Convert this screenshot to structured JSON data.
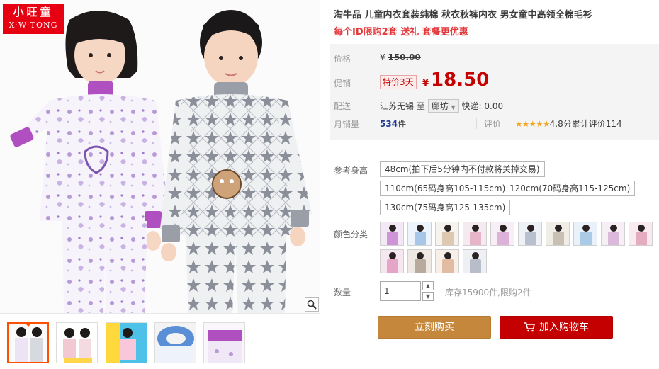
{
  "brand": {
    "logo_cn": "小旺童",
    "logo_en": "X·W·TONG"
  },
  "product": {
    "title": "淘牛品 儿童内衣套装纯棉 秋衣秋裤内衣 男女童中高领全棉毛衫",
    "subtitle": "每个ID限购2套 送礼 套餐更优惠"
  },
  "price": {
    "label": "价格",
    "currency": "¥",
    "original": "150.00",
    "promo_label": "促销",
    "promo_tag": "特价3天",
    "promo_price": "18.50"
  },
  "shipping": {
    "label": "配送",
    "from": "江苏无锡",
    "to_word": "至",
    "to_city": "廊坊",
    "fee_text": "快递: 0.00"
  },
  "sales": {
    "label": "月销量",
    "count": "534",
    "unit": "件",
    "review_label": "评价",
    "stars": "★★★★★",
    "score_text": "4.8分累计评价114"
  },
  "sizes": {
    "label": "参考身高",
    "options": [
      "48cm(拍下后5分钟内不付款将关掉交易)",
      "110cm(65码身高105-115cm)",
      "120cm(70码身高115-125cm)",
      "130cm(75码身高125-135cm)"
    ]
  },
  "colors": {
    "label": "颜色分类"
  },
  "quantity": {
    "label": "数量",
    "value": "1",
    "stock_text": "库存15900件,限购2件"
  },
  "actions": {
    "buy_now": "立刻购买",
    "add_to_cart": "加入购物车"
  },
  "theme": {
    "accent_red": "#c40000",
    "buy_brown": "#c5873b",
    "active_thumb": "#ff5000",
    "title_red": "#e4393c"
  }
}
